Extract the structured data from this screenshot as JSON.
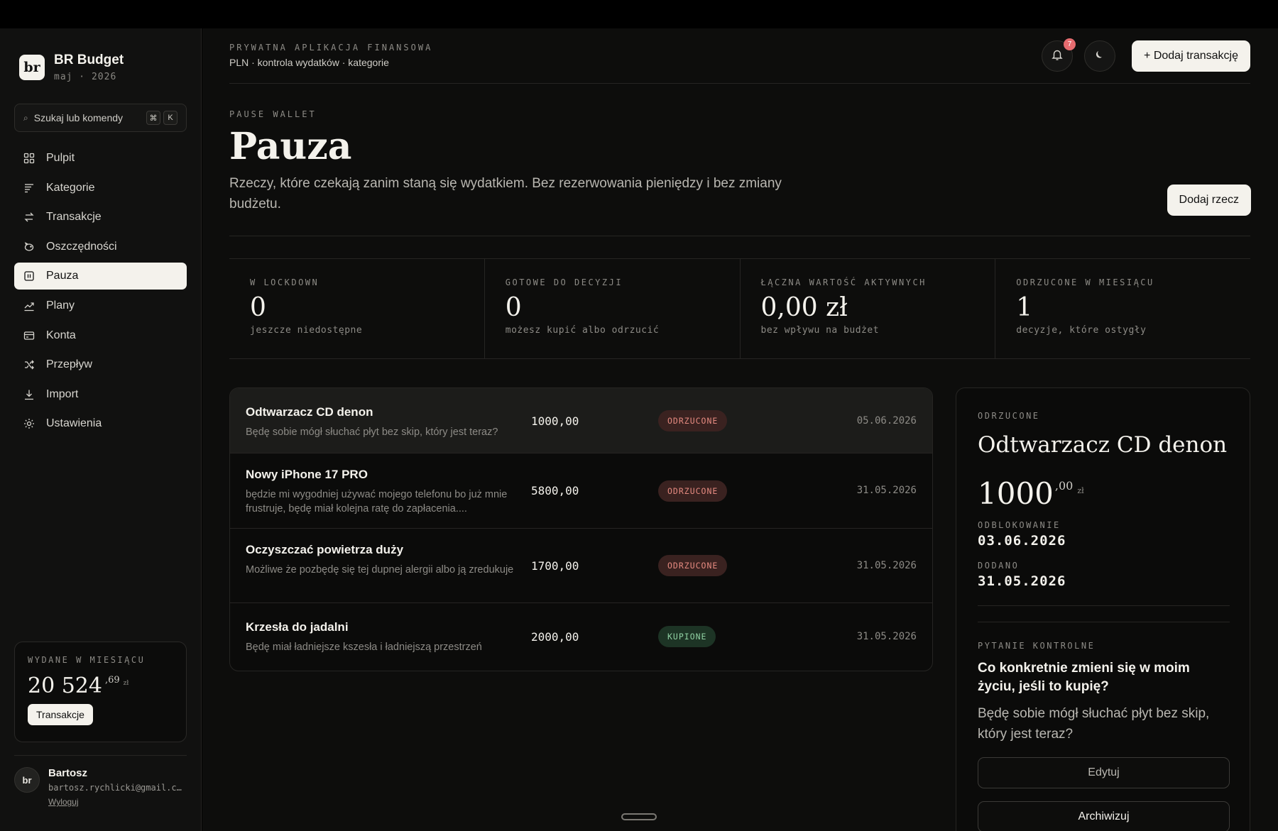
{
  "app": {
    "name": "BR Budget",
    "logo": "br",
    "period": "maj · 2026"
  },
  "search": {
    "placeholder": "Szukaj lub komendy",
    "shortcut_mod": "⌘",
    "shortcut_key": "K"
  },
  "sidebar": {
    "items": [
      {
        "label": "Pulpit",
        "icon": "grid-icon",
        "active": false
      },
      {
        "label": "Kategorie",
        "icon": "list-icon",
        "active": false
      },
      {
        "label": "Transakcje",
        "icon": "arrows-swap-icon",
        "active": false
      },
      {
        "label": "Oszczędności",
        "icon": "piggy-bank-icon",
        "active": false
      },
      {
        "label": "Pauza",
        "icon": "pause-icon",
        "active": true
      },
      {
        "label": "Plany",
        "icon": "trend-icon",
        "active": false
      },
      {
        "label": "Konta",
        "icon": "card-icon",
        "active": false
      },
      {
        "label": "Przepływ",
        "icon": "shuffle-icon",
        "active": false
      },
      {
        "label": "Import",
        "icon": "download-icon",
        "active": false
      },
      {
        "label": "Ustawienia",
        "icon": "gear-icon",
        "active": false
      }
    ]
  },
  "spend_card": {
    "label": "WYDANE W MIESIĄCU",
    "amount_int": "20 524",
    "amount_dec": ",69",
    "currency": "zł",
    "button": "Transakcje"
  },
  "user": {
    "initials": "br",
    "name": "Bartosz",
    "email": "bartosz.rychlicki@gmail.com",
    "logout": "Wyloguj"
  },
  "header": {
    "eyebrow": "PRYWATNA APLIKACJA FINANSOWA",
    "subtitle": "PLN · kontrola wydatków · kategorie",
    "notifications": "7",
    "add_transaction": "+ Dodaj transakcję"
  },
  "page": {
    "eyebrow": "PAUSE WALLET",
    "title": "Pauza",
    "description": "Rzeczy, które czekają zanim staną się wydatkiem. Bez rezerwowania pieniędzy i bez zmiany budżetu.",
    "add_button": "Dodaj rzecz"
  },
  "stats": [
    {
      "label": "W LOCKDOWN",
      "value": "0",
      "sub": "jeszcze niedostępne"
    },
    {
      "label": "GOTOWE DO DECYZJI",
      "value": "0",
      "sub": "możesz kupić albo odrzucić"
    },
    {
      "label": "ŁĄCZNA WARTOŚĆ AKTYWNYCH",
      "value": "0,00 zł",
      "sub": "bez wpływu na budżet"
    },
    {
      "label": "ODRZUCONE W MIESIĄCU",
      "value": "1",
      "sub": "decyzje, które ostygły"
    }
  ],
  "items": [
    {
      "title": "Odtwarzacz CD denon",
      "desc": "Będę sobie mógł słuchać płyt bez skip, który jest teraz?",
      "amount": "1000,00",
      "status": "ODRZUCONE",
      "status_type": "rejected",
      "date": "05.06.2026",
      "selected": true
    },
    {
      "title": "Nowy iPhone 17 PRO",
      "desc": "będzie mi wygodniej używać mojego telefonu bo już mnie frustruje, będę miał kolejna ratę do zapłacenia....",
      "amount": "5800,00",
      "status": "ODRZUCONE",
      "status_type": "rejected",
      "date": "31.05.2026",
      "selected": false
    },
    {
      "title": "Oczyszczać powietrza duży",
      "desc": "Możliwe że pozbędę się tej dupnej alergii albo ją zredukuje",
      "amount": "1700,00",
      "status": "ODRZUCONE",
      "status_type": "rejected",
      "date": "31.05.2026",
      "selected": false
    },
    {
      "title": "Krzesła do jadalni",
      "desc": "Będę miał ładniejsze kszesła i ładniejszą przestrzeń",
      "amount": "2000,00",
      "status": "KUPIONE",
      "status_type": "bought",
      "date": "31.05.2026",
      "selected": false
    }
  ],
  "detail": {
    "status": "ODRZUCONE",
    "title": "Odtwarzacz CD denon",
    "amount_int": "1000",
    "amount_dec": ",00",
    "currency": "zł",
    "unlock_label": "ODBLOKOWANIE",
    "unlock_date": "03.06.2026",
    "added_label": "DODANO",
    "added_date": "31.05.2026",
    "question_label": "PYTANIE KONTROLNE",
    "question": "Co konkretnie zmieni się w moim życiu, jeśli to kupię?",
    "answer": "Będę sobie mógł słuchać płyt bez skip, który jest teraz?",
    "edit_button": "Edytuj",
    "archive_button": "Archiwizuj"
  },
  "colors": {
    "accent_light": "#f4f2ec",
    "rejected_bg": "#3a2220",
    "rejected_text": "#e58a80",
    "bought_bg": "#1d3425",
    "bought_text": "#8fd0a2",
    "badge_red": "#e56b6f"
  }
}
